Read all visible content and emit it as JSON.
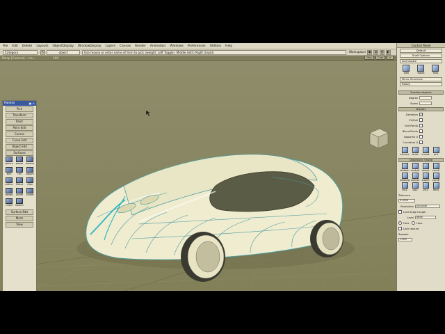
{
  "menu": [
    "File",
    "Edit",
    "Delete",
    "Layouts",
    "ObjectDisplay",
    "WindowDisplay",
    "Layers",
    "Canvas",
    "Render",
    "Animation",
    "Windows",
    "Preferences",
    "Utilities",
    "Help"
  ],
  "toolbar": {
    "category_label": "Category",
    "object_label": "object",
    "prompt": "Use mouse or enter name of item to pick (weight: Left Toggle | Middle Add | Right Unpick",
    "workspaces_label": "Workspaces"
  },
  "viewport": {
    "title": "Persp [Camera] ---no--- ",
    "zoom": "100",
    "btn_max": "Max",
    "btn_cam": "Cam"
  },
  "palette": {
    "title": "Palette",
    "buttons_top": [
      "Pick",
      "Transform",
      "Paint",
      "Paint Edit",
      "Curves",
      "Curve Edit",
      "Object Edit",
      "Surfaces"
    ],
    "tools": [
      "sphere",
      "planar",
      "revolve",
      "skin",
      "rail",
      "square",
      "artline",
      "ffblnd",
      "rflan",
      "msrpd",
      "ocrdfl",
      "crvnet",
      "crsbnf",
      "ballcm",
      ""
    ],
    "buttons_bottom": [
      "Surface Edit",
      "Mesh",
      "View"
    ]
  },
  "rpanel": {
    "control_panel": "Control Panel",
    "default_label": "Default",
    "shelf_options": "Shelf Options",
    "tab_learning": "learning#2",
    "shelf_icons": [
      "edit",
      "tubes",
      "help"
    ],
    "menu_shortcuts": "Menu Shortcuts",
    "finish": "Ready",
    "pick_header": "Enabled objects",
    "degree_label": "Degree",
    "spans_label": "Spans",
    "display_header": "Display",
    "display_rows": [
      {
        "label": "Deviation",
        "checked": "✓"
      },
      {
        "label": "CV/Hull",
        "checked": ""
      },
      {
        "label": "Edit Points",
        "checked": ""
      },
      {
        "label": "Blend Points",
        "checked": ""
      },
      {
        "label": "Isoparms U",
        "checked": ""
      },
      {
        "label": "Curvature U",
        "checked": ""
      }
    ],
    "bottom_icons": [
      "xfrmnv",
      "dcrnt",
      "curvat",
      "pnt"
    ],
    "diag_header": "Diagnostic Shade",
    "diag_icons": [
      "shdoon",
      "mutcal",
      "rescol",
      "curvtl",
      "zmoang",
      "formal",
      "zuarel",
      "curvtl",
      "vis1",
      "vis2",
      "vis3",
      "flexs"
    ],
    "tolerance_label": "Tolerance",
    "tolerance_value": "0.1000",
    "resolution_label": "Resolution",
    "resolution_value": "Accurate",
    "limit_label": "Limit Edge Length",
    "level_label": "Level",
    "level_value": "None",
    "horiz_label": "Horz",
    "vert_label": "Horz",
    "lock_label": "Lock texture",
    "repeats_label": "Repeats",
    "repeats_value": "1.000"
  }
}
